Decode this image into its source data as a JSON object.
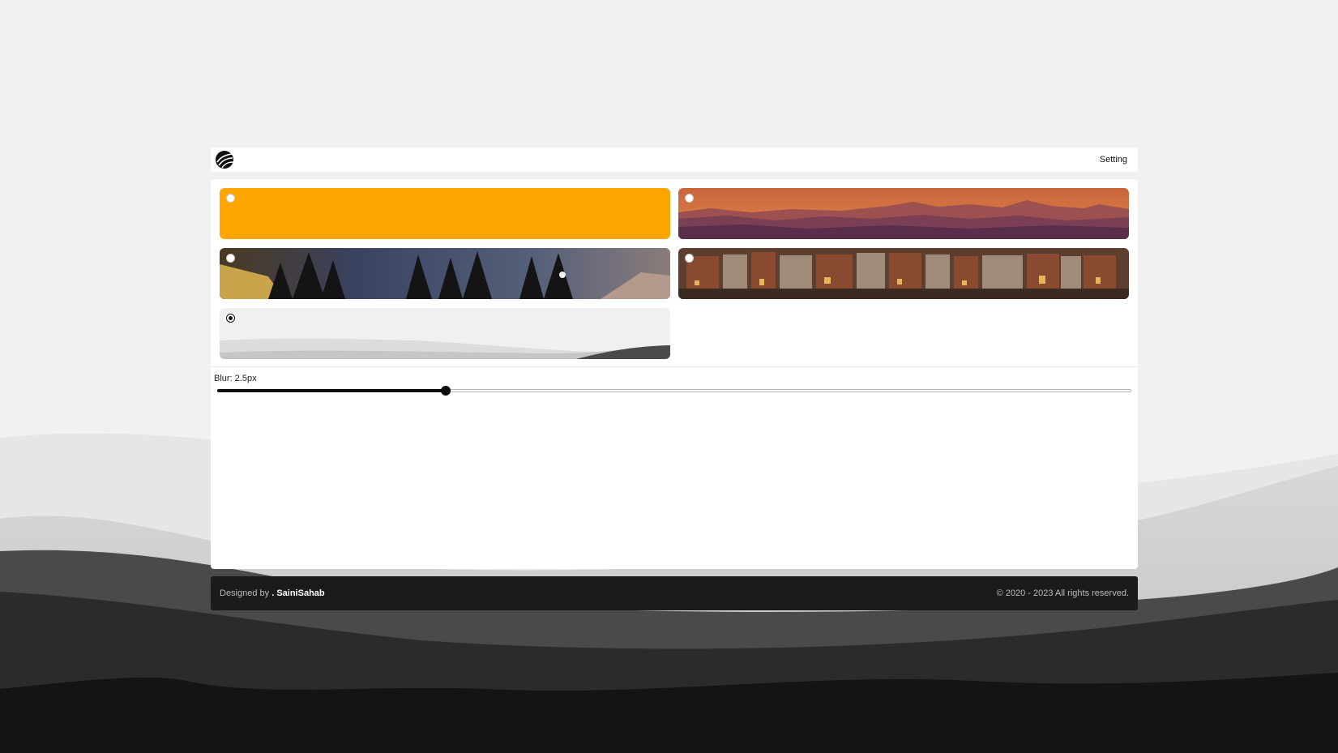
{
  "topbar": {
    "setting_label": "Setting"
  },
  "wallpapers": [
    {
      "id": "orange",
      "selected": false
    },
    {
      "id": "sunset-mountains",
      "selected": false
    },
    {
      "id": "night-forest",
      "selected": false
    },
    {
      "id": "city-canal",
      "selected": false
    },
    {
      "id": "grey-hills",
      "selected": true
    }
  ],
  "blur": {
    "label": "Blur: 2.5px",
    "value": 2.5,
    "min": 0,
    "max": 10
  },
  "footer": {
    "designed_by": "Designed by ",
    "brand": ". SainiSahab",
    "copyright": "© 2020 - 2023 All rights reserved."
  },
  "colors": {
    "orange": "#ffa500",
    "footer_bg": "#1b1b1b",
    "slider": "#0d0d0d"
  }
}
